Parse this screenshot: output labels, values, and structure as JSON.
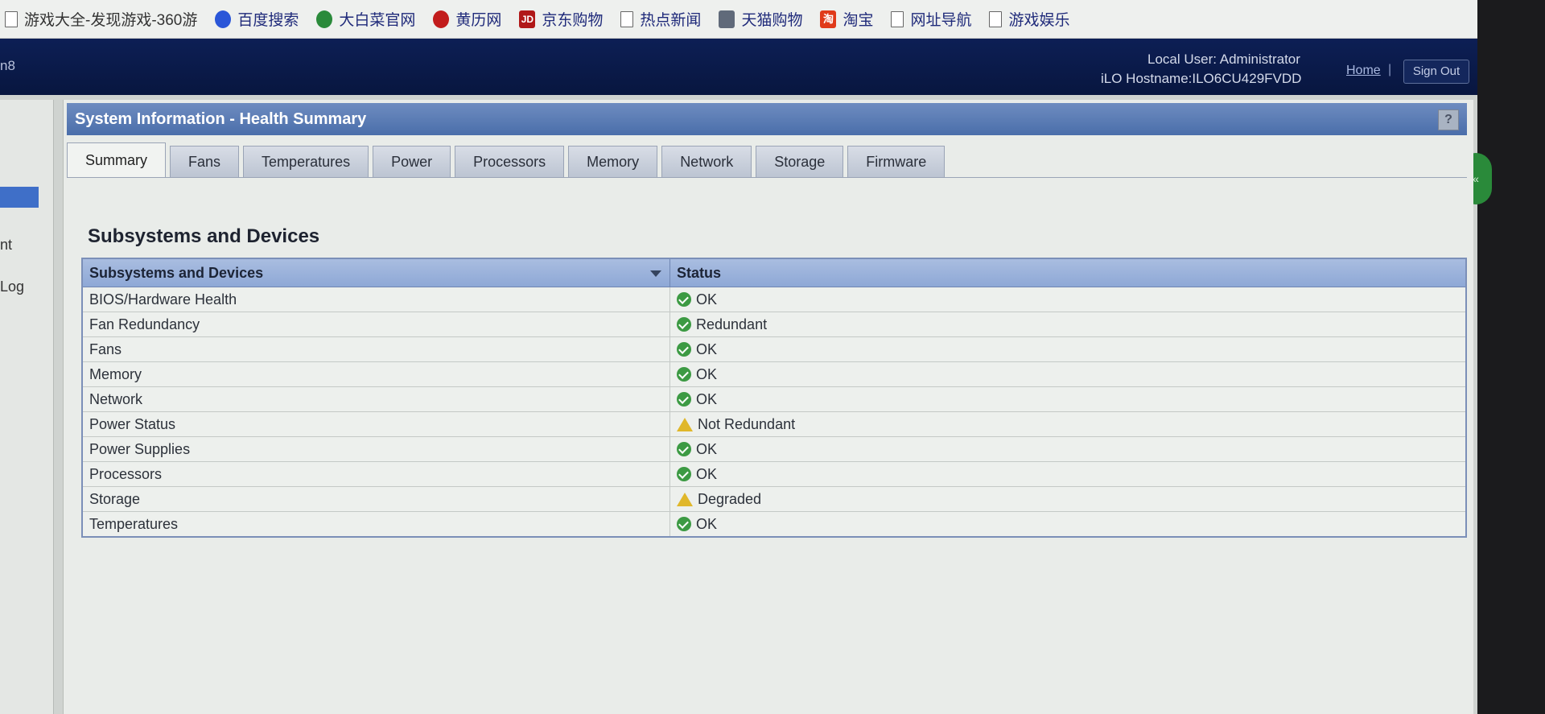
{
  "bookmarks": [
    {
      "label": "游戏大全-发现游戏-360游",
      "icon": "page-icon"
    },
    {
      "label": "百度搜索",
      "icon": "baidu-paw-icon"
    },
    {
      "label": "大白菜官网",
      "icon": "leaf-icon"
    },
    {
      "label": "黄历网",
      "icon": "red-circle-icon"
    },
    {
      "label": "京东购物",
      "icon": "jd-icon"
    },
    {
      "label": "热点新闻",
      "icon": "page-icon"
    },
    {
      "label": "天猫购物",
      "icon": "tmall-icon"
    },
    {
      "label": "淘宝",
      "icon": "taobao-icon"
    },
    {
      "label": "网址导航",
      "icon": "page-icon"
    },
    {
      "label": "游戏娱乐",
      "icon": "page-icon"
    }
  ],
  "header": {
    "left_fragment": "n8",
    "local_user": "Local User:  Administrator",
    "hostname": "iLO Hostname:ILO6CU429FVDD",
    "home": "Home",
    "separator": "|",
    "sign_out": "Sign Out"
  },
  "leftnav": {
    "item1": "nt",
    "item2": "Log"
  },
  "panel": {
    "title": "System Information - Health Summary",
    "help": "?",
    "tabs": [
      "Summary",
      "Fans",
      "Temperatures",
      "Power",
      "Processors",
      "Memory",
      "Network",
      "Storage",
      "Firmware"
    ],
    "active_tab": "Summary",
    "section_title": "Subsystems and Devices"
  },
  "table": {
    "headers": [
      "Subsystems and Devices",
      "Status"
    ],
    "rows": [
      {
        "name": "BIOS/Hardware Health",
        "status": "OK",
        "level": "ok"
      },
      {
        "name": "Fan Redundancy",
        "status": "Redundant",
        "level": "ok"
      },
      {
        "name": "Fans",
        "status": "OK",
        "level": "ok"
      },
      {
        "name": "Memory",
        "status": "OK",
        "level": "ok"
      },
      {
        "name": "Network",
        "status": "OK",
        "level": "ok"
      },
      {
        "name": "Power Status",
        "status": "Not Redundant",
        "level": "warn"
      },
      {
        "name": "Power Supplies",
        "status": "OK",
        "level": "ok"
      },
      {
        "name": "Processors",
        "status": "OK",
        "level": "ok"
      },
      {
        "name": "Storage",
        "status": "Degraded",
        "level": "warn"
      },
      {
        "name": "Temperatures",
        "status": "OK",
        "level": "ok"
      }
    ]
  },
  "colors": {
    "header_bg": "#0d1f55",
    "title_bar": "#5a7cb6",
    "ok": "#3c9a43",
    "warn": "#e0b72a"
  }
}
